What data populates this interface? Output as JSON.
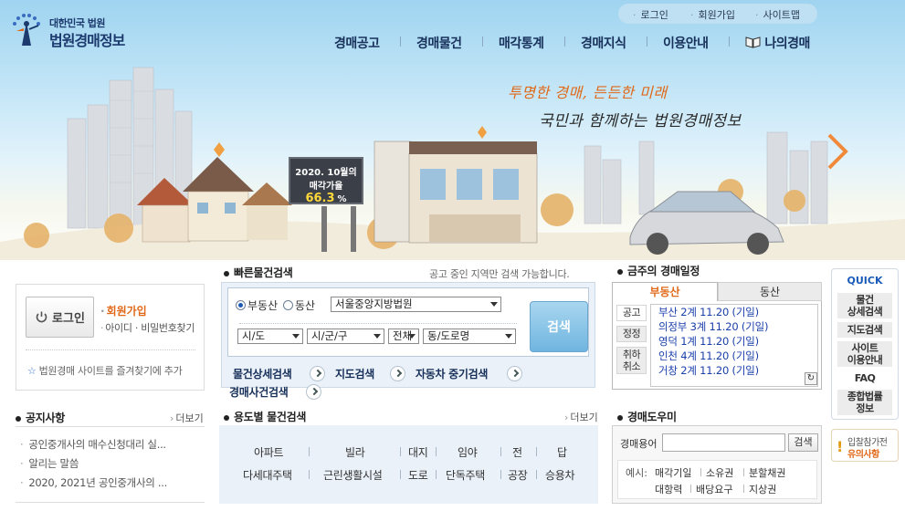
{
  "header": {
    "logo_small": "대한민국 법원",
    "logo_big": "법원경매정보",
    "util": [
      "로그인",
      "회원가입",
      "사이트맵"
    ],
    "gnb": [
      "경매공고",
      "경매물건",
      "매각통계",
      "경매지식",
      "이용안내",
      "나의경매"
    ]
  },
  "hero": {
    "slogan1": "투명한 경매, 든든한 미래",
    "slogan2": "국민과 함께하는 법원경매정보",
    "billboard_line1": "2020. 10월의",
    "billboard_line2": "매각가율",
    "billboard_rate": "66.3",
    "billboard_unit": "%"
  },
  "login": {
    "button": "로그인",
    "join": "회원가입",
    "find": "아이디 · 비밀번호찾기",
    "favorite": "법원경매 사이트를 즐겨찾기에 추가"
  },
  "quick_search": {
    "title": "빠른물건검색",
    "note": "공고 중인 지역만 검색 가능합니다.",
    "radio_realestate": "부동산",
    "radio_movable": "동산",
    "court": "서울중앙지방법원",
    "sido": "시/도",
    "sigungu": "시/군/구",
    "all": "전체",
    "dong": "동/도로명",
    "search_button": "검색",
    "links": [
      "물건상세검색",
      "지도검색",
      "자동차 중기검색",
      "경매사건검색"
    ]
  },
  "schedule": {
    "title": "금주의 경매일정",
    "tab_realestate": "부동산",
    "tab_movable": "동산",
    "side_tabs": [
      "공고",
      "정정",
      "취하\n취소"
    ],
    "items": [
      "부산 2계 11.20 (기일)",
      "의정부 3계 11.20 (기일)",
      "영덕 1계 11.20 (기일)",
      "인천 4계 11.20 (기일)",
      "거창 2계 11.20 (기일)"
    ]
  },
  "quick_menu": {
    "title": "QUICK",
    "items": [
      "물건\n상세검색",
      "지도검색",
      "사이트\n이용안내",
      "FAQ",
      "종합법률\n정보"
    ],
    "notice_line1": "입찰참가전",
    "notice_line2": "유의사항"
  },
  "notice": {
    "title": "공지사항",
    "more": "더보기",
    "items": [
      "공인중개사의 매수신청대리 실...",
      "알리는 말씀",
      "2020, 2021년 공인중개사의 ..."
    ]
  },
  "usage": {
    "title": "용도별 물건검색",
    "more": "더보기",
    "row1": [
      "아파트",
      "빌라",
      "대지",
      "임야",
      "전",
      "답"
    ],
    "row2": [
      "다세대주택",
      "근린생활시설",
      "도로",
      "단독주택",
      "공장",
      "승용차"
    ]
  },
  "helper": {
    "title": "경매도우미",
    "label": "경매용어",
    "search_button": "검색",
    "example_label": "예시:",
    "examples": [
      "매각기일",
      "소유권",
      "분할채권",
      "대항력",
      "배당요구",
      "지상권"
    ]
  },
  "colors": {
    "navy": "#17305a",
    "orange": "#e06818",
    "link_blue": "#1a3faa"
  }
}
